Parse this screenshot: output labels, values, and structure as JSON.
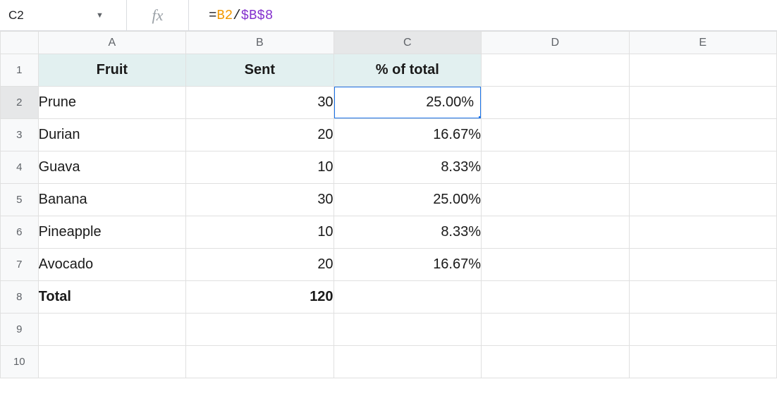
{
  "name_box": {
    "value": "C2"
  },
  "formula_bar": {
    "fx": "fx",
    "eq": "=",
    "ref1": "B2",
    "op": "/",
    "ref2": "$B$8"
  },
  "columns": [
    "A",
    "B",
    "C",
    "D",
    "E"
  ],
  "row_numbers": [
    "1",
    "2",
    "3",
    "4",
    "5",
    "6",
    "7",
    "8",
    "9",
    "10"
  ],
  "active": {
    "col_index": 2,
    "row_index": 1,
    "col_label": "C",
    "row_label": "2"
  },
  "header_row": {
    "a": "Fruit",
    "b": "Sent",
    "c": "% of total"
  },
  "data_rows": [
    {
      "a": "Prune",
      "b": "30",
      "c": "25.00%"
    },
    {
      "a": "Durian",
      "b": "20",
      "c": "16.67%"
    },
    {
      "a": "Guava",
      "b": "10",
      "c": "8.33%"
    },
    {
      "a": "Banana",
      "b": "30",
      "c": "25.00%"
    },
    {
      "a": "Pineapple",
      "b": "10",
      "c": "8.33%"
    },
    {
      "a": "Avocado",
      "b": "20",
      "c": "16.67%"
    }
  ],
  "total_row": {
    "a": "Total",
    "b": "120",
    "c": ""
  },
  "chart_data": {
    "type": "table",
    "columns": [
      "Fruit",
      "Sent",
      "% of total"
    ],
    "rows": [
      [
        "Prune",
        30,
        "25.00%"
      ],
      [
        "Durian",
        20,
        "16.67%"
      ],
      [
        "Guava",
        10,
        "8.33%"
      ],
      [
        "Banana",
        30,
        "25.00%"
      ],
      [
        "Pineapple",
        10,
        "8.33%"
      ],
      [
        "Avocado",
        20,
        "16.67%"
      ]
    ],
    "total": [
      "Total",
      120,
      ""
    ]
  }
}
